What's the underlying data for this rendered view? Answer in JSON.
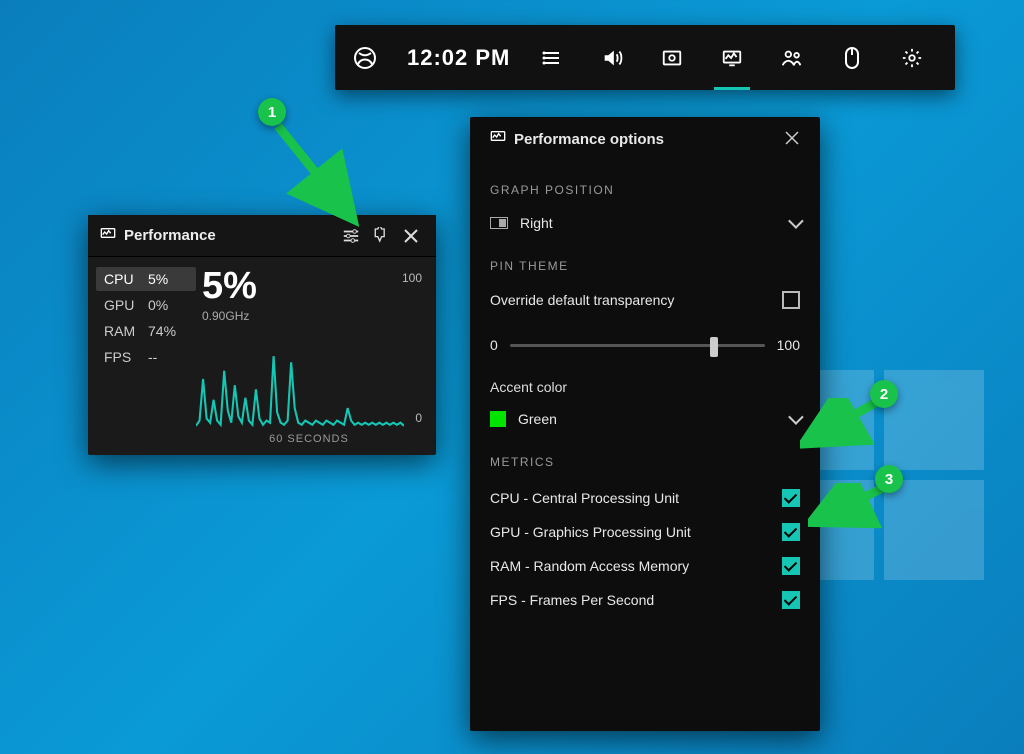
{
  "gamebar": {
    "time": "12:02 PM"
  },
  "perf_widget": {
    "title": "Performance",
    "metrics": [
      {
        "label": "CPU",
        "value": "5%",
        "selected": true
      },
      {
        "label": "GPU",
        "value": "0%",
        "selected": false
      },
      {
        "label": "RAM",
        "value": "74%",
        "selected": false
      },
      {
        "label": "FPS",
        "value": "--",
        "selected": false
      }
    ],
    "big_value": "5%",
    "subtext": "0.90GHz",
    "y_top": "100",
    "y_bottom": "0",
    "x_label": "60 SECONDS"
  },
  "options": {
    "title": "Performance options",
    "graph_position": {
      "section_label": "GRAPH POSITION",
      "value": "Right"
    },
    "pin_theme": {
      "section_label": "PIN THEME",
      "override_label": "Override default transparency",
      "override_checked": false,
      "slider_min": "0",
      "slider_max": "100",
      "slider_value": 80
    },
    "accent_color": {
      "label": "Accent color",
      "value": "Green"
    },
    "metrics_section": {
      "section_label": "METRICS",
      "items": [
        {
          "label": "CPU - Central Processing Unit",
          "checked": true
        },
        {
          "label": "GPU - Graphics Processing Unit",
          "checked": true
        },
        {
          "label": "RAM - Random Access Memory",
          "checked": true
        },
        {
          "label": "FPS - Frames Per Second",
          "checked": true
        }
      ]
    }
  },
  "annotations": {
    "marker1": "1",
    "marker2": "2",
    "marker3": "3"
  },
  "chart_data": {
    "type": "line",
    "title": "CPU usage",
    "xlabel": "60 SECONDS",
    "ylabel": "",
    "ylim": [
      0,
      100
    ],
    "x": [
      0,
      1,
      2,
      3,
      4,
      5,
      6,
      7,
      8,
      9,
      10,
      11,
      12,
      13,
      14,
      15,
      16,
      17,
      18,
      19,
      20,
      21,
      22,
      23,
      24,
      25,
      26,
      27,
      28,
      29,
      30,
      31,
      32,
      33,
      34,
      35,
      36,
      37,
      38,
      39,
      40,
      41,
      42,
      43,
      44,
      45,
      46,
      47,
      48,
      49,
      50,
      51,
      52,
      53,
      54,
      55,
      56,
      57,
      58,
      59
    ],
    "values": [
      5,
      10,
      50,
      12,
      8,
      30,
      10,
      6,
      58,
      20,
      8,
      44,
      14,
      8,
      32,
      10,
      6,
      40,
      12,
      6,
      10,
      8,
      72,
      18,
      8,
      6,
      10,
      66,
      22,
      8,
      6,
      10,
      8,
      6,
      10,
      8,
      6,
      10,
      8,
      6,
      10,
      8,
      6,
      22,
      10,
      6,
      8,
      6,
      8,
      6,
      8,
      6,
      8,
      6,
      8,
      6,
      8,
      6,
      8,
      5
    ]
  }
}
